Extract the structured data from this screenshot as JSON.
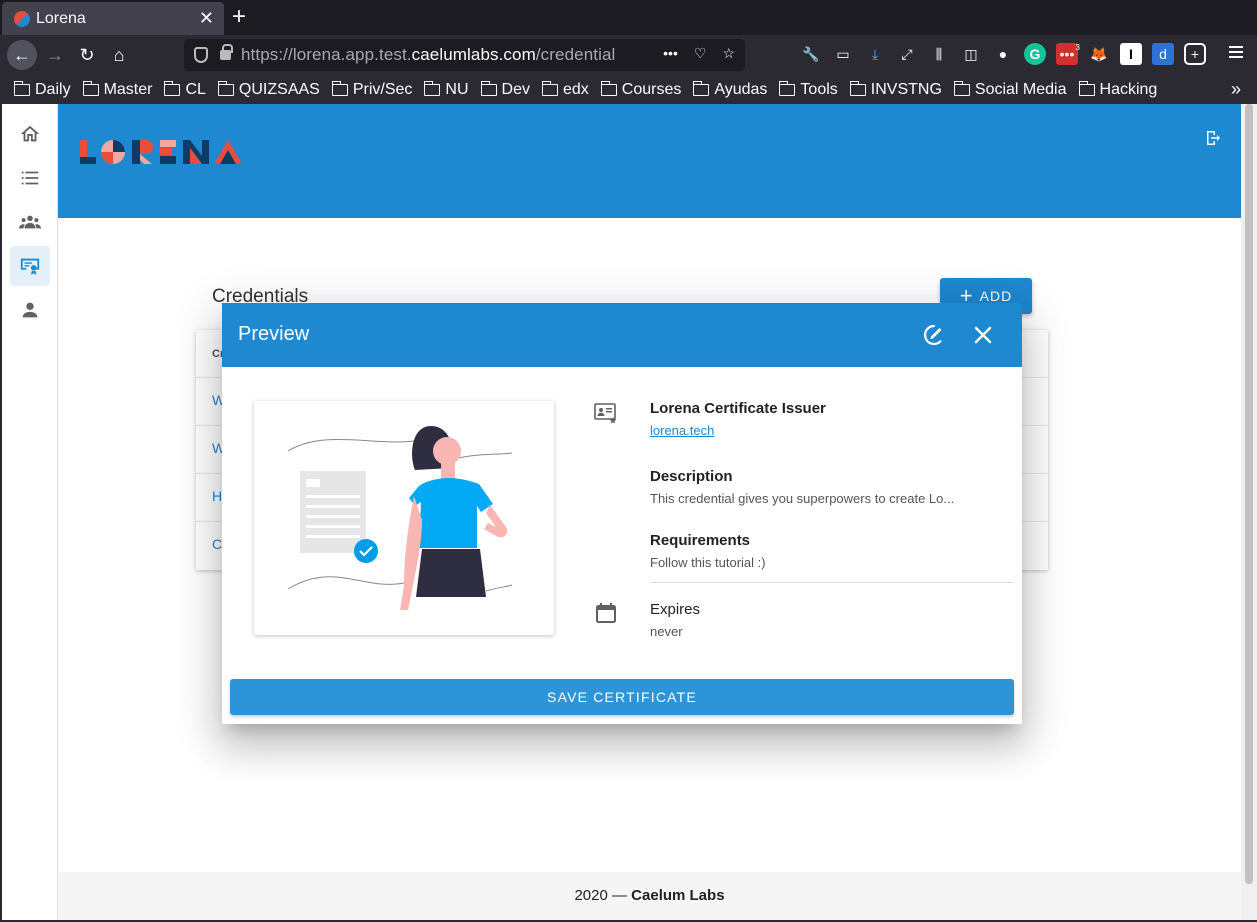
{
  "browser": {
    "tab_title": "Lorena",
    "url_prefix": "https://lorena.app.test.",
    "url_domain": "caelumlabs.com",
    "url_path": "/credential",
    "url_menu": "•••",
    "bookmarks": [
      "Daily",
      "Master",
      "CL",
      "QUIZSAAS",
      "Priv/Sec",
      "NU",
      "Dev",
      "edx",
      "Courses",
      "Ayudas",
      "Tools",
      "INVSTNG",
      "Social Media",
      "Hacking"
    ],
    "extension_badge": "3"
  },
  "app": {
    "brand_color": "#1e88d0",
    "logo_text": "LORENA",
    "sidebar": [
      "home-icon",
      "list-icon",
      "people-icon",
      "credential-icon",
      "person-icon"
    ]
  },
  "page": {
    "title": "Credentials",
    "add_label": "ADD",
    "table_rows": [
      "Cr",
      "W",
      "W",
      "H",
      "C"
    ]
  },
  "dialog": {
    "title": "Preview",
    "issuer": "Lorena Certificate Issuer",
    "issuer_link": "lorena.tech",
    "description_label": "Description",
    "description": "This credential gives you superpowers to create Lo...",
    "requirements_label": "Requirements",
    "requirements": "Follow this tutorial :)",
    "expires_label": "Expires",
    "expires": "never",
    "save_label": "SAVE CERTIFICATE"
  },
  "footer": {
    "year": "2020 — ",
    "company": "Caelum Labs"
  }
}
